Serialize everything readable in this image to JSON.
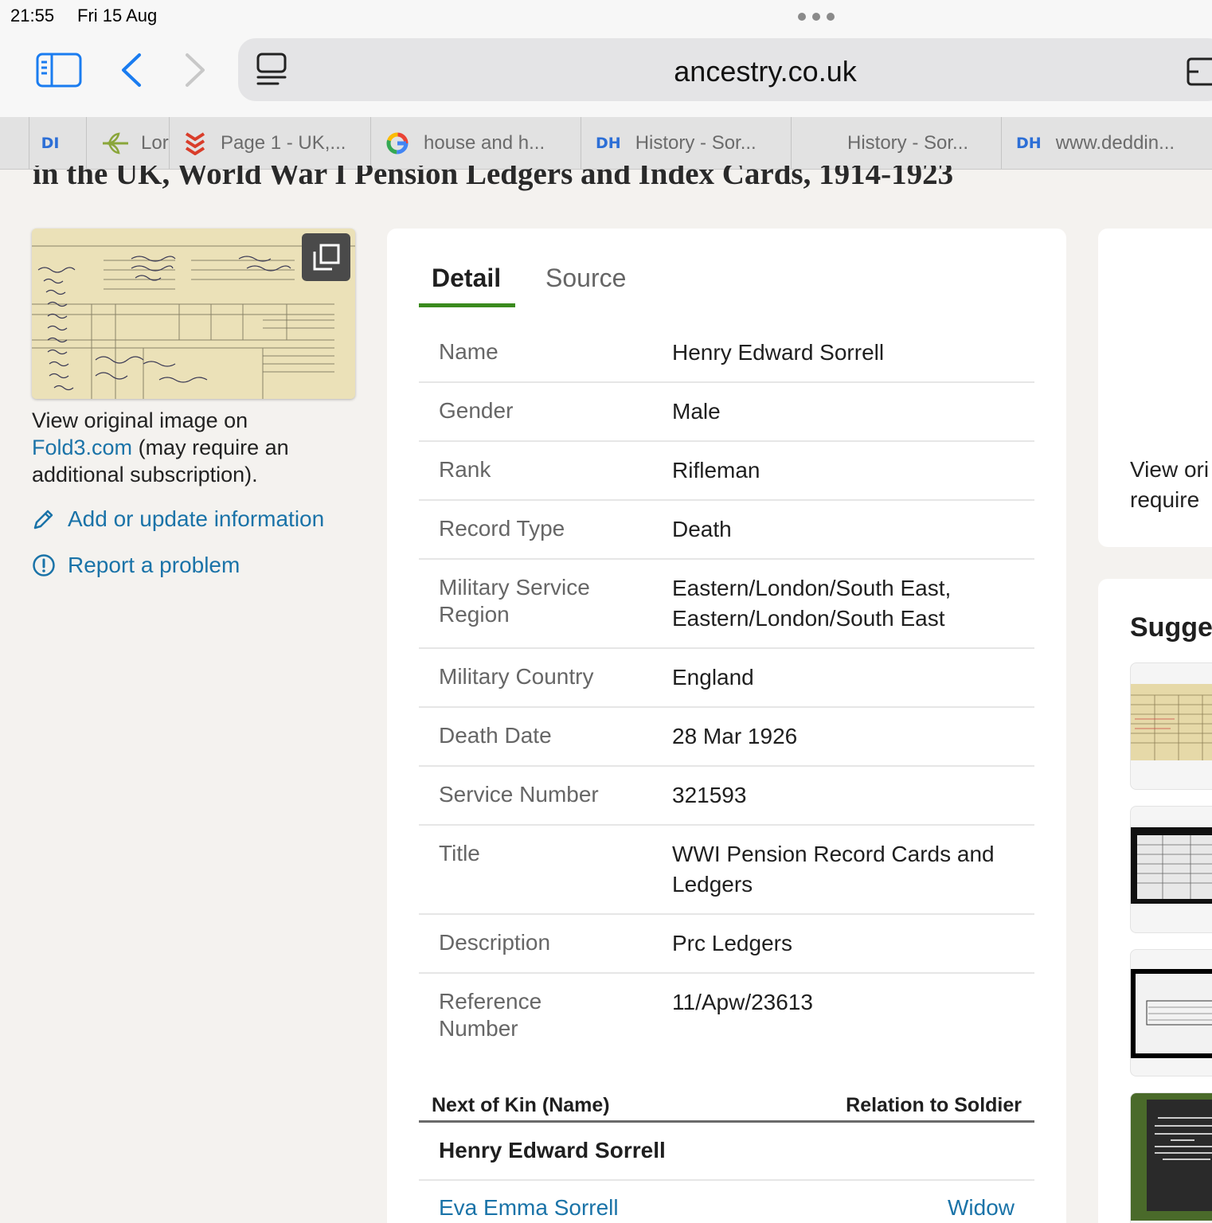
{
  "status": {
    "time": "21:55",
    "date": "Fri 15 Aug"
  },
  "browser": {
    "url": "ancestry.co.uk",
    "tabs": [
      {
        "favicon_text": "DI",
        "label": ""
      },
      {
        "favicon_text": "",
        "label": "Lor"
      },
      {
        "favicon_text": "",
        "label": "Page 1 - UK,..."
      },
      {
        "favicon_text": "",
        "label": "house and h..."
      },
      {
        "favicon_text": "DH",
        "label": "History - Sor..."
      },
      {
        "favicon_text": "",
        "label": "History - Sor..."
      },
      {
        "favicon_text": "DH",
        "label": "www.deddin..."
      }
    ]
  },
  "page": {
    "title": "in the UK, World War I Pension Ledgers and Index Cards, 1914-1923",
    "view_original": {
      "prefix": "View original image on",
      "link": "Fold3.com",
      "suffix": "(may require an additional subscription)."
    },
    "add_update": "Add or update information",
    "report_problem": "Report a problem"
  },
  "detail": {
    "tabs": {
      "detail": "Detail",
      "source": "Source"
    },
    "rows": [
      {
        "label": "Name",
        "value": "Henry Edward Sorrell"
      },
      {
        "label": "Gender",
        "value": "Male"
      },
      {
        "label": "Rank",
        "value": "Rifleman"
      },
      {
        "label": "Record Type",
        "value": "Death"
      },
      {
        "label": "Military Service Region",
        "value": "Eastern/London/South East, Eastern/London/South East"
      },
      {
        "label": "Military Country",
        "value": "England"
      },
      {
        "label": "Death Date",
        "value": "28 Mar 1926"
      },
      {
        "label": "Service Number",
        "value": "321593"
      },
      {
        "label": "Title",
        "value": "WWI Pension Record Cards and Ledgers"
      },
      {
        "label": "Description",
        "value": "Prc Ledgers"
      },
      {
        "label": "Reference Number",
        "value": "11/Apw/23613"
      }
    ],
    "kin": {
      "head_name": "Next of Kin (Name)",
      "head_relation": "Relation to Soldier",
      "soldier": "Henry Edward Sorrell",
      "entries": [
        {
          "name": "Eva Emma Sorrell",
          "relation": "Widow"
        }
      ]
    }
  },
  "right": {
    "view_text_1": "View ori",
    "view_text_2": "require",
    "suggested_heading": "Sugge"
  },
  "colors": {
    "link": "#1a73a8",
    "accent_tab": "#3a8a1d",
    "page_bg": "#f4f2ef"
  }
}
